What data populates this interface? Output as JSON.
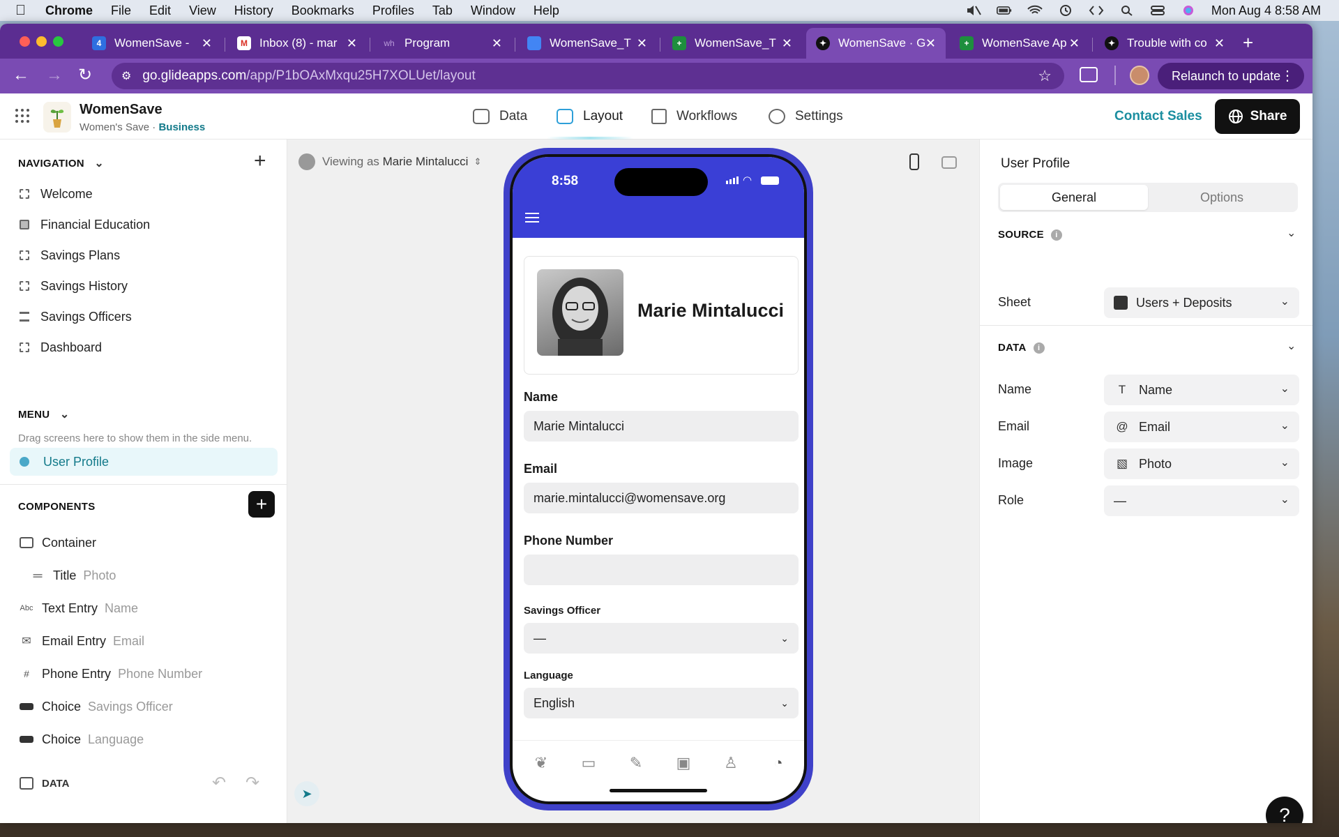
{
  "menubar": {
    "app": "Chrome",
    "items": [
      "File",
      "Edit",
      "View",
      "History",
      "Bookmarks",
      "Profiles",
      "Tab",
      "Window",
      "Help"
    ],
    "datetime": "Mon Aug 4  8:58 AM"
  },
  "tabs": [
    {
      "label": "WomenSave - ",
      "icon_color": "#2f6fe0",
      "icon_text": "4"
    },
    {
      "label": "Inbox (8) - mar",
      "icon_color": "#d93025",
      "icon_text": "M"
    },
    {
      "label": "Program",
      "icon_color": "#5a3a8a",
      "icon_text": "wh"
    },
    {
      "label": "WomenSave_T",
      "icon_color": "#4285f4",
      "icon_text": ""
    },
    {
      "label": "WomenSave_T",
      "icon_color": "#1e8e3e",
      "icon_text": "+"
    },
    {
      "label": "WomenSave · G",
      "icon_color": "#111111",
      "icon_text": "✦"
    },
    {
      "label": "WomenSave Ap",
      "icon_color": "#1e8e3e",
      "icon_text": "+"
    },
    {
      "label": "Trouble with co",
      "icon_color": "#111111",
      "icon_text": "✦"
    }
  ],
  "url": {
    "domain": "go.glideapps.com",
    "path": "/app/P1bOAxMxqu25H7XOLUet/layout"
  },
  "relaunch_label": "Relaunch to update",
  "app": {
    "name": "WomenSave",
    "org": "Women's Save ·",
    "plan": "Business",
    "nav": {
      "data": "Data",
      "layout": "Layout",
      "workflows": "Workflows",
      "settings": "Settings"
    },
    "contact_sales": "Contact Sales",
    "share": "Share"
  },
  "left": {
    "navigation_header": "NAVIGATION",
    "nav_items": [
      "Welcome",
      "Financial Education",
      "Savings Plans",
      "Savings History",
      "Savings Officers",
      "Dashboard"
    ],
    "menu_header": "MENU",
    "menu_hint": "Drag screens here to show them in the side menu.",
    "menu_item": "User Profile",
    "components_header": "COMPONENTS",
    "components": [
      {
        "type": "Container",
        "sub": ""
      },
      {
        "type": "Title",
        "sub": "Photo"
      },
      {
        "type": "Text Entry",
        "sub": "Name"
      },
      {
        "type": "Email Entry",
        "sub": "Email"
      },
      {
        "type": "Phone Entry",
        "sub": "Phone Number"
      },
      {
        "type": "Choice",
        "sub": "Savings Officer"
      },
      {
        "type": "Choice",
        "sub": "Language"
      }
    ],
    "data_label": "DATA"
  },
  "canvas": {
    "viewing_as_label": "Viewing as",
    "viewing_as_user": "Marie Mintalucci"
  },
  "phone": {
    "time": "8:58",
    "profile_name": "Marie Mintalucci",
    "name_label": "Name",
    "name_value": "Marie Mintalucci",
    "email_label": "Email",
    "email_value": "marie.mintalucci@womensave.org",
    "phone_label": "Phone Number",
    "phone_value": "",
    "officer_label": "Savings Officer",
    "officer_value": "—",
    "language_label": "Language",
    "language_value": "English"
  },
  "right": {
    "title": "User Profile",
    "tab_general": "General",
    "tab_options": "Options",
    "source_header": "SOURCE",
    "sheet_label": "Sheet",
    "sheet_value": "Users + Deposits",
    "data_header": "DATA",
    "fields": [
      {
        "label": "Name",
        "value": "Name",
        "icon": "T"
      },
      {
        "label": "Email",
        "value": "Email",
        "icon": "@"
      },
      {
        "label": "Image",
        "value": "Photo",
        "icon": "▧"
      },
      {
        "label": "Role",
        "value": "—",
        "icon": ""
      }
    ]
  },
  "help_label": "?"
}
